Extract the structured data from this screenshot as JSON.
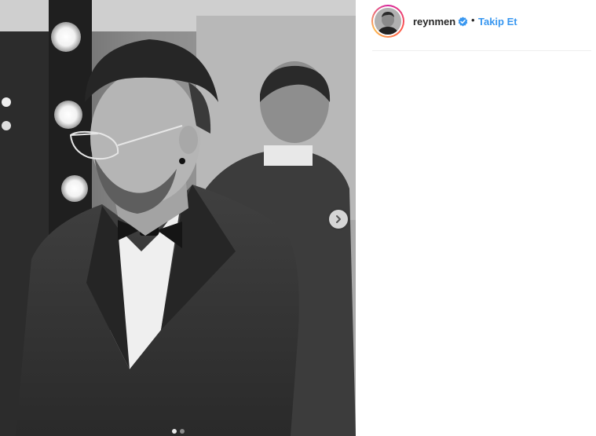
{
  "post": {
    "username": "reynmen",
    "verified": true,
    "separator": "•",
    "follow_label": "Takip Et",
    "carousel": {
      "total": 2,
      "current": 1
    }
  },
  "icons": {
    "next": "chevron-right-icon",
    "verified": "verified-badge-icon"
  },
  "colors": {
    "follow": "#3897f0",
    "verified": "#3897f0",
    "text": "#262626",
    "divider": "#efefef"
  }
}
